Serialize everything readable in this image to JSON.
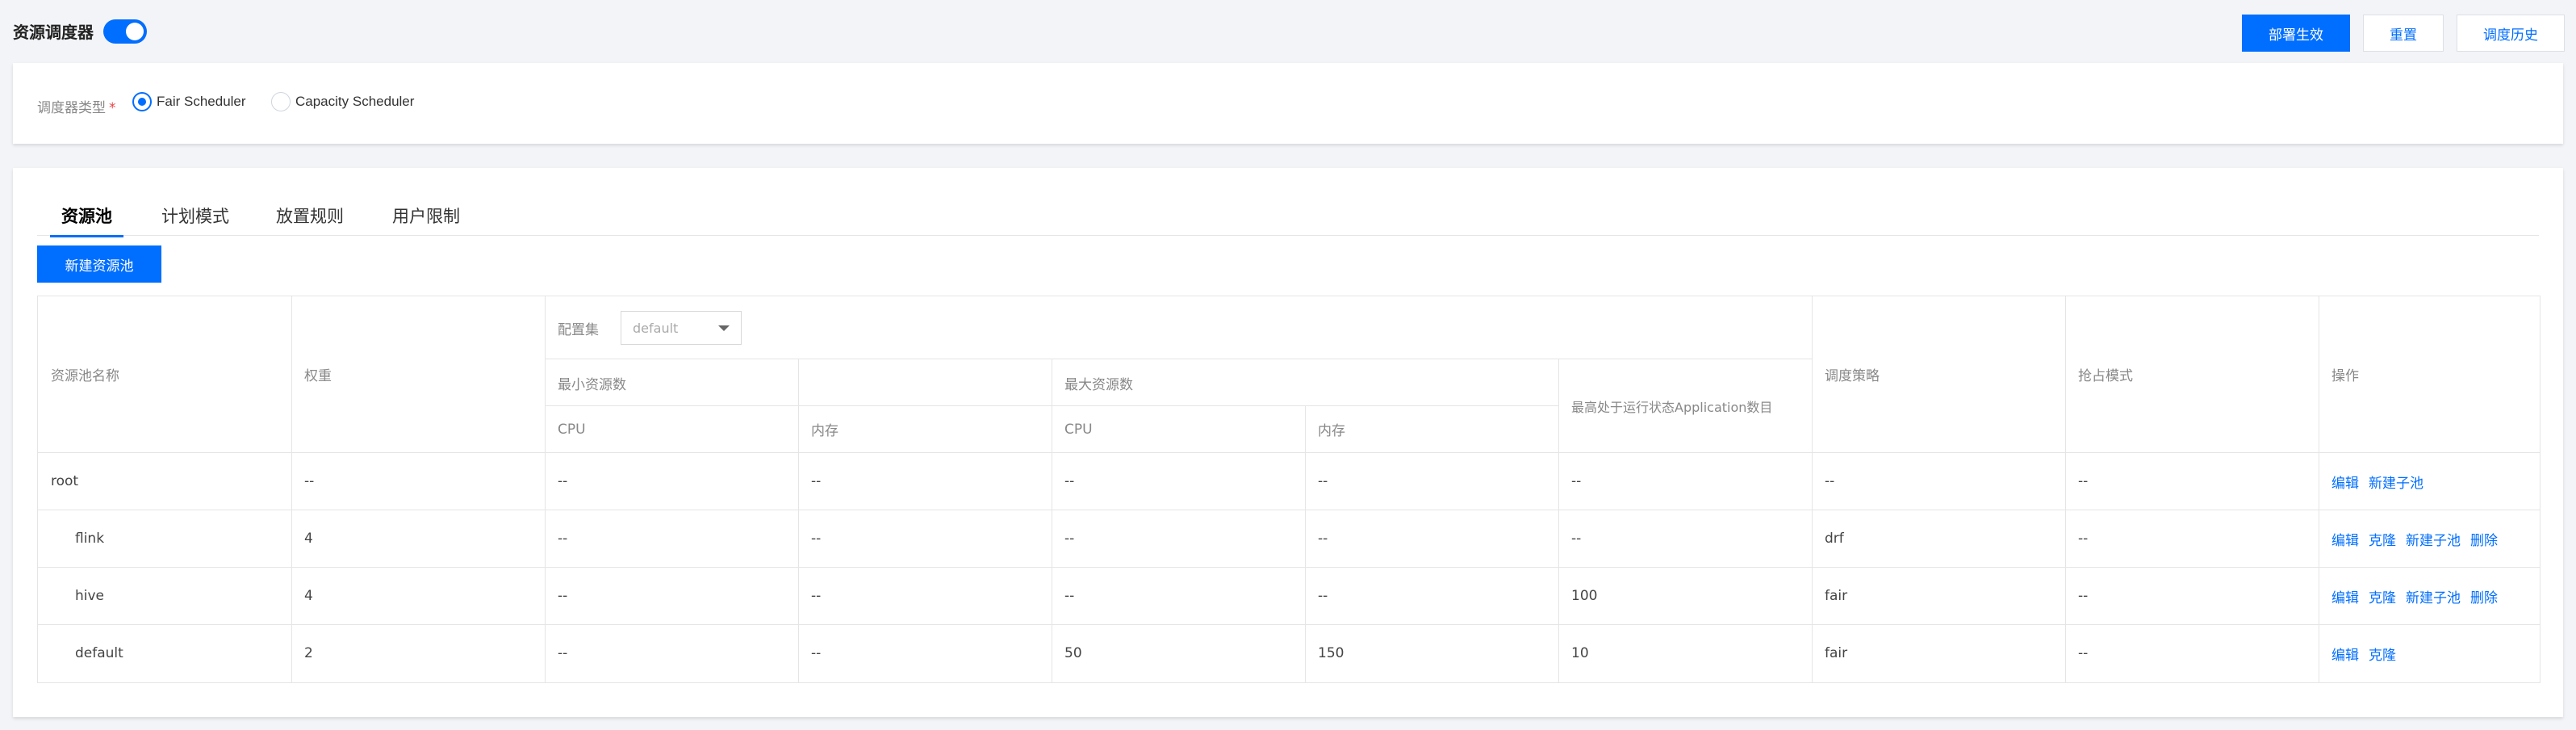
{
  "header": {
    "title": "资源调度器",
    "toggle_on": true,
    "deploy_label": "部署生效",
    "reset_label": "重置",
    "history_label": "调度历史"
  },
  "scheduler": {
    "label": "调度器类型",
    "required_mark": "*",
    "options": [
      {
        "label": "Fair Scheduler",
        "checked": true
      },
      {
        "label": "Capacity Scheduler",
        "checked": false
      }
    ]
  },
  "tabs": [
    {
      "label": "资源池",
      "active": true
    },
    {
      "label": "计划模式",
      "active": false
    },
    {
      "label": "放置规则",
      "active": false
    },
    {
      "label": "用户限制",
      "active": false
    }
  ],
  "new_pool_label": "新建资源池",
  "table": {
    "headers": {
      "name": "资源池名称",
      "weight": "权重",
      "config_set": "配置集",
      "config_set_value": "default",
      "min_resources": "最小资源数",
      "max_resources": "最大资源数",
      "cpu": "CPU",
      "memory": "内存",
      "max_running_apps": "最高处于运行状态Application数目",
      "policy": "调度策略",
      "preemption": "抢占模式",
      "actions": "操作"
    },
    "rows": [
      {
        "name": "root",
        "weight": "--",
        "min_cpu": "--",
        "min_mem": "--",
        "max_cpu": "--",
        "max_mem": "--",
        "max_apps": "--",
        "policy": "--",
        "preempt": "--",
        "actions": [
          "编辑",
          "新建子池"
        ]
      },
      {
        "name": "flink",
        "weight": "4",
        "min_cpu": "--",
        "min_mem": "--",
        "max_cpu": "--",
        "max_mem": "--",
        "max_apps": "--",
        "policy": "drf",
        "preempt": "--",
        "actions": [
          "编辑",
          "克隆",
          "新建子池",
          "删除"
        ]
      },
      {
        "name": "hive",
        "weight": "4",
        "min_cpu": "--",
        "min_mem": "--",
        "max_cpu": "--",
        "max_mem": "--",
        "max_apps": "100",
        "policy": "fair",
        "preempt": "--",
        "actions": [
          "编辑",
          "克隆",
          "新建子池",
          "删除"
        ]
      },
      {
        "name": "default",
        "weight": "2",
        "min_cpu": "--",
        "min_mem": "--",
        "max_cpu": "50",
        "max_mem": "150",
        "max_apps": "10",
        "policy": "fair",
        "preempt": "--",
        "actions": [
          "编辑",
          "克隆"
        ]
      }
    ]
  },
  "colors": {
    "accent": "#006eff",
    "background": "#f3f4f7"
  }
}
